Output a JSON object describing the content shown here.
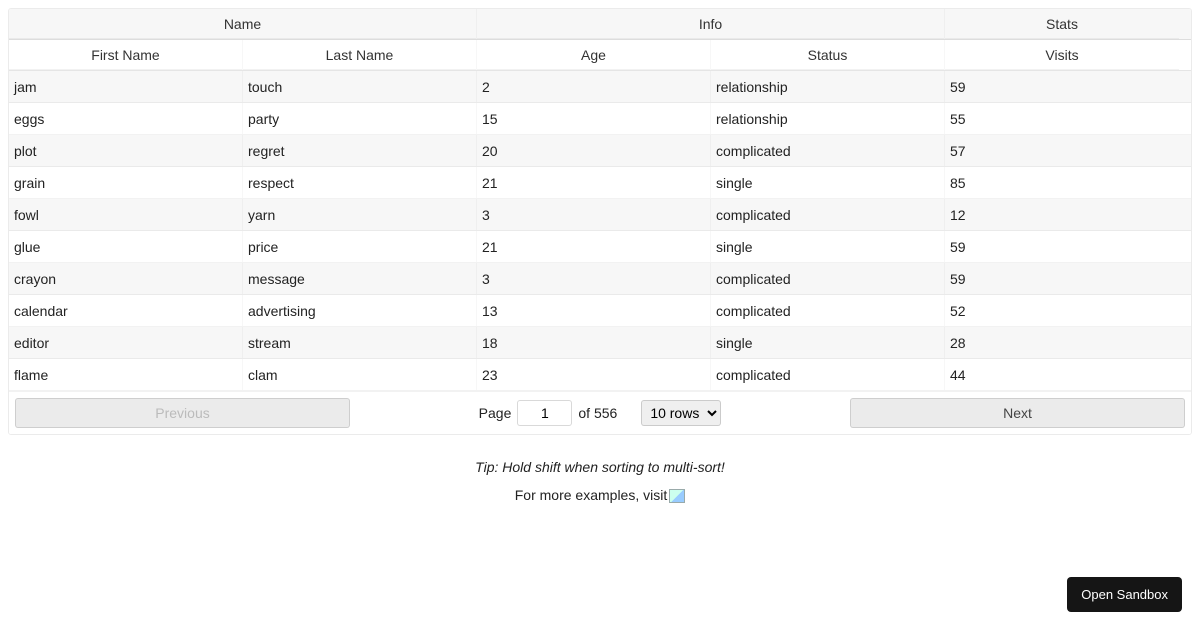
{
  "headerGroups": {
    "name": "Name",
    "info": "Info",
    "stats": "Stats"
  },
  "columns": {
    "firstName": "First Name",
    "lastName": "Last Name",
    "age": "Age",
    "status": "Status",
    "visits": "Visits"
  },
  "rows": [
    {
      "firstName": "jam",
      "lastName": "touch",
      "age": "2",
      "status": "relationship",
      "visits": "59"
    },
    {
      "firstName": "eggs",
      "lastName": "party",
      "age": "15",
      "status": "relationship",
      "visits": "55"
    },
    {
      "firstName": "plot",
      "lastName": "regret",
      "age": "20",
      "status": "complicated",
      "visits": "57"
    },
    {
      "firstName": "grain",
      "lastName": "respect",
      "age": "21",
      "status": "single",
      "visits": "85"
    },
    {
      "firstName": "fowl",
      "lastName": "yarn",
      "age": "3",
      "status": "complicated",
      "visits": "12"
    },
    {
      "firstName": "glue",
      "lastName": "price",
      "age": "21",
      "status": "single",
      "visits": "59"
    },
    {
      "firstName": "crayon",
      "lastName": "message",
      "age": "3",
      "status": "complicated",
      "visits": "59"
    },
    {
      "firstName": "calendar",
      "lastName": "advertising",
      "age": "13",
      "status": "complicated",
      "visits": "52"
    },
    {
      "firstName": "editor",
      "lastName": "stream",
      "age": "18",
      "status": "single",
      "visits": "28"
    },
    {
      "firstName": "flame",
      "lastName": "clam",
      "age": "23",
      "status": "complicated",
      "visits": "44"
    }
  ],
  "pagination": {
    "prevLabel": "Previous",
    "nextLabel": "Next",
    "pageLabel": "Page",
    "pageValue": "1",
    "ofText": "of 556",
    "rowsSelected": "10 rows"
  },
  "tipText": "Tip: Hold shift when sorting to multi-sort!",
  "moreText": "For more examples, visit",
  "openSandboxLabel": "Open Sandbox"
}
